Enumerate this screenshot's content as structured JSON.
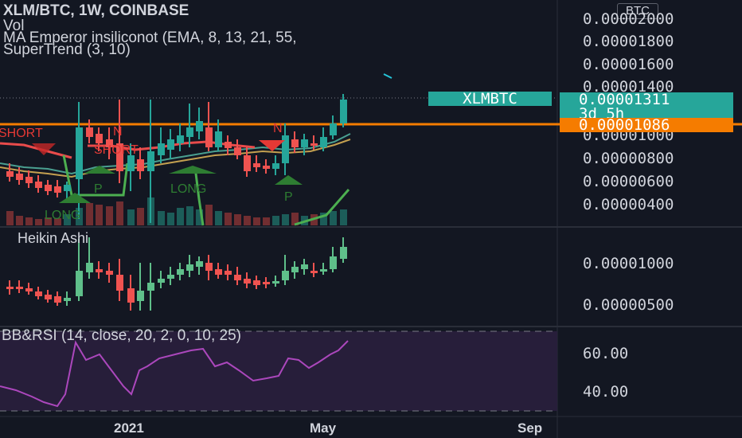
{
  "header": {
    "symbol_line": "XLM/BTC, 1W, COINBASE",
    "vol": "Vol",
    "ma_line": "MA Emperor insiliconot (EMA, 8, 13, 21, 55,",
    "supertrend_line": "SuperTrend (3, 10)"
  },
  "currency_button": "BTC",
  "price_axis": [
    "0.00002000",
    "0.00001800",
    "0.00001600",
    "0.00001400",
    "0.00001000",
    "0.00000800",
    "0.00000600",
    "0.00000400"
  ],
  "tags": {
    "symbol": "XLMBTC",
    "last_price": "0.00001311",
    "countdown": "3d 5h",
    "line_price": "0.00001086"
  },
  "heikin": {
    "title": "Heikin Ashi",
    "axis": [
      "0.00001000",
      "0.00000500"
    ]
  },
  "rsi": {
    "title": "BB&RSI (14, close, 20, 2, 0, 10, 25)",
    "axis": [
      "60.00",
      "40.00"
    ]
  },
  "time_axis": [
    "2021",
    "May",
    "Sep"
  ],
  "signals": [
    "SHORT",
    "SHORT",
    "N",
    "N",
    "LONG",
    "LONG",
    "P",
    "P"
  ],
  "colors": {
    "bg": "#131722",
    "up": "#26a69a",
    "down": "#ef5350",
    "orange": "#f57c00",
    "green_sig": "#4caf50",
    "red_sig": "#e53935",
    "rsi": "#9c27b0"
  }
}
